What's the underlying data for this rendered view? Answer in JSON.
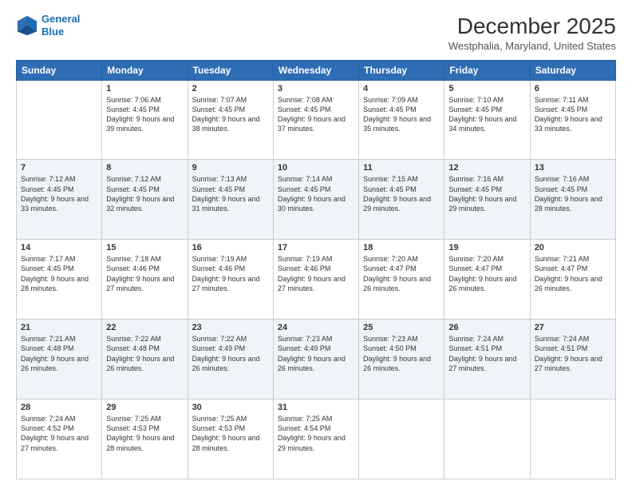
{
  "header": {
    "logo_line1": "General",
    "logo_line2": "Blue",
    "title": "December 2025",
    "subtitle": "Westphalia, Maryland, United States"
  },
  "days_of_week": [
    "Sunday",
    "Monday",
    "Tuesday",
    "Wednesday",
    "Thursday",
    "Friday",
    "Saturday"
  ],
  "weeks": [
    [
      {
        "day": "",
        "sunrise": "",
        "sunset": "",
        "daylight": ""
      },
      {
        "day": "1",
        "sunrise": "Sunrise: 7:06 AM",
        "sunset": "Sunset: 4:45 PM",
        "daylight": "Daylight: 9 hours and 39 minutes."
      },
      {
        "day": "2",
        "sunrise": "Sunrise: 7:07 AM",
        "sunset": "Sunset: 4:45 PM",
        "daylight": "Daylight: 9 hours and 38 minutes."
      },
      {
        "day": "3",
        "sunrise": "Sunrise: 7:08 AM",
        "sunset": "Sunset: 4:45 PM",
        "daylight": "Daylight: 9 hours and 37 minutes."
      },
      {
        "day": "4",
        "sunrise": "Sunrise: 7:09 AM",
        "sunset": "Sunset: 4:45 PM",
        "daylight": "Daylight: 9 hours and 35 minutes."
      },
      {
        "day": "5",
        "sunrise": "Sunrise: 7:10 AM",
        "sunset": "Sunset: 4:45 PM",
        "daylight": "Daylight: 9 hours and 34 minutes."
      },
      {
        "day": "6",
        "sunrise": "Sunrise: 7:11 AM",
        "sunset": "Sunset: 4:45 PM",
        "daylight": "Daylight: 9 hours and 33 minutes."
      }
    ],
    [
      {
        "day": "7",
        "sunrise": "Sunrise: 7:12 AM",
        "sunset": "Sunset: 4:45 PM",
        "daylight": "Daylight: 9 hours and 33 minutes."
      },
      {
        "day": "8",
        "sunrise": "Sunrise: 7:12 AM",
        "sunset": "Sunset: 4:45 PM",
        "daylight": "Daylight: 9 hours and 32 minutes."
      },
      {
        "day": "9",
        "sunrise": "Sunrise: 7:13 AM",
        "sunset": "Sunset: 4:45 PM",
        "daylight": "Daylight: 9 hours and 31 minutes."
      },
      {
        "day": "10",
        "sunrise": "Sunrise: 7:14 AM",
        "sunset": "Sunset: 4:45 PM",
        "daylight": "Daylight: 9 hours and 30 minutes."
      },
      {
        "day": "11",
        "sunrise": "Sunrise: 7:15 AM",
        "sunset": "Sunset: 4:45 PM",
        "daylight": "Daylight: 9 hours and 29 minutes."
      },
      {
        "day": "12",
        "sunrise": "Sunrise: 7:16 AM",
        "sunset": "Sunset: 4:45 PM",
        "daylight": "Daylight: 9 hours and 29 minutes."
      },
      {
        "day": "13",
        "sunrise": "Sunrise: 7:16 AM",
        "sunset": "Sunset: 4:45 PM",
        "daylight": "Daylight: 9 hours and 28 minutes."
      }
    ],
    [
      {
        "day": "14",
        "sunrise": "Sunrise: 7:17 AM",
        "sunset": "Sunset: 4:45 PM",
        "daylight": "Daylight: 9 hours and 28 minutes."
      },
      {
        "day": "15",
        "sunrise": "Sunrise: 7:18 AM",
        "sunset": "Sunset: 4:46 PM",
        "daylight": "Daylight: 9 hours and 27 minutes."
      },
      {
        "day": "16",
        "sunrise": "Sunrise: 7:19 AM",
        "sunset": "Sunset: 4:46 PM",
        "daylight": "Daylight: 9 hours and 27 minutes."
      },
      {
        "day": "17",
        "sunrise": "Sunrise: 7:19 AM",
        "sunset": "Sunset: 4:46 PM",
        "daylight": "Daylight: 9 hours and 27 minutes."
      },
      {
        "day": "18",
        "sunrise": "Sunrise: 7:20 AM",
        "sunset": "Sunset: 4:47 PM",
        "daylight": "Daylight: 9 hours and 26 minutes."
      },
      {
        "day": "19",
        "sunrise": "Sunrise: 7:20 AM",
        "sunset": "Sunset: 4:47 PM",
        "daylight": "Daylight: 9 hours and 26 minutes."
      },
      {
        "day": "20",
        "sunrise": "Sunrise: 7:21 AM",
        "sunset": "Sunset: 4:47 PM",
        "daylight": "Daylight: 9 hours and 26 minutes."
      }
    ],
    [
      {
        "day": "21",
        "sunrise": "Sunrise: 7:21 AM",
        "sunset": "Sunset: 4:48 PM",
        "daylight": "Daylight: 9 hours and 26 minutes."
      },
      {
        "day": "22",
        "sunrise": "Sunrise: 7:22 AM",
        "sunset": "Sunset: 4:48 PM",
        "daylight": "Daylight: 9 hours and 26 minutes."
      },
      {
        "day": "23",
        "sunrise": "Sunrise: 7:22 AM",
        "sunset": "Sunset: 4:49 PM",
        "daylight": "Daylight: 9 hours and 26 minutes."
      },
      {
        "day": "24",
        "sunrise": "Sunrise: 7:23 AM",
        "sunset": "Sunset: 4:49 PM",
        "daylight": "Daylight: 9 hours and 26 minutes."
      },
      {
        "day": "25",
        "sunrise": "Sunrise: 7:23 AM",
        "sunset": "Sunset: 4:50 PM",
        "daylight": "Daylight: 9 hours and 26 minutes."
      },
      {
        "day": "26",
        "sunrise": "Sunrise: 7:24 AM",
        "sunset": "Sunset: 4:51 PM",
        "daylight": "Daylight: 9 hours and 27 minutes."
      },
      {
        "day": "27",
        "sunrise": "Sunrise: 7:24 AM",
        "sunset": "Sunset: 4:51 PM",
        "daylight": "Daylight: 9 hours and 27 minutes."
      }
    ],
    [
      {
        "day": "28",
        "sunrise": "Sunrise: 7:24 AM",
        "sunset": "Sunset: 4:52 PM",
        "daylight": "Daylight: 9 hours and 27 minutes."
      },
      {
        "day": "29",
        "sunrise": "Sunrise: 7:25 AM",
        "sunset": "Sunset: 4:53 PM",
        "daylight": "Daylight: 9 hours and 28 minutes."
      },
      {
        "day": "30",
        "sunrise": "Sunrise: 7:25 AM",
        "sunset": "Sunset: 4:53 PM",
        "daylight": "Daylight: 9 hours and 28 minutes."
      },
      {
        "day": "31",
        "sunrise": "Sunrise: 7:25 AM",
        "sunset": "Sunset: 4:54 PM",
        "daylight": "Daylight: 9 hours and 29 minutes."
      },
      {
        "day": "",
        "sunrise": "",
        "sunset": "",
        "daylight": ""
      },
      {
        "day": "",
        "sunrise": "",
        "sunset": "",
        "daylight": ""
      },
      {
        "day": "",
        "sunrise": "",
        "sunset": "",
        "daylight": ""
      }
    ]
  ]
}
